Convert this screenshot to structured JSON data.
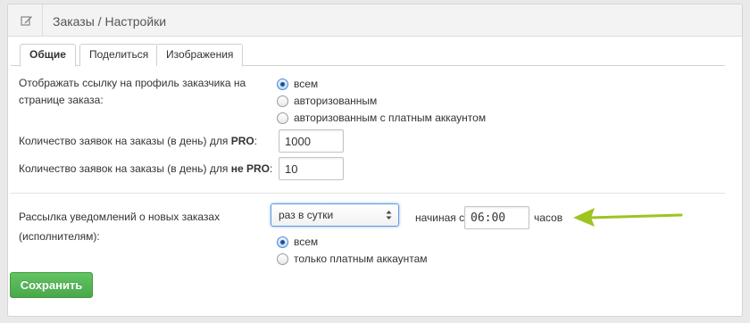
{
  "header": {
    "title": "Заказы / Настройки",
    "icon": "edit-icon"
  },
  "tabs": [
    {
      "label": "Общие",
      "active": true
    },
    {
      "label": "Поделиться",
      "active": false
    },
    {
      "label": "Изображения",
      "active": false
    }
  ],
  "profile_link": {
    "label_line1": "Отображать ссылку на профиль заказчика на",
    "label_line2": "странице заказа:",
    "options": [
      {
        "label": "всем",
        "checked": true
      },
      {
        "label": "авторизованным",
        "checked": false
      },
      {
        "label": "авторизованным с платным аккаунтом",
        "checked": false
      }
    ]
  },
  "pro_limit": {
    "label_prefix": "Количество заявок на заказы (в день) для ",
    "label_bold": "PRO",
    "label_suffix": ":",
    "value": "1000"
  },
  "nonpro_limit": {
    "label_prefix": "Количество заявок на заказы (в день) для ",
    "label_bold": "не PRO",
    "label_suffix": ":",
    "value": "10"
  },
  "notifications": {
    "label_line1": "Рассылка уведомлений о новых заказах",
    "label_line2": "(исполнителям):",
    "frequency_selected": "раз в сутки",
    "starting_label": "начиная с",
    "time_value": "06:00",
    "hours_label": "часов",
    "options": [
      {
        "label": "всем",
        "checked": true
      },
      {
        "label": "только платным аккаунтам",
        "checked": false
      }
    ]
  },
  "save_button": {
    "label": "Сохранить"
  },
  "colors": {
    "accent_green": "#5cb85c",
    "annotation_arrow": "#9ec41f",
    "focus_blue": "#5b9be0"
  }
}
